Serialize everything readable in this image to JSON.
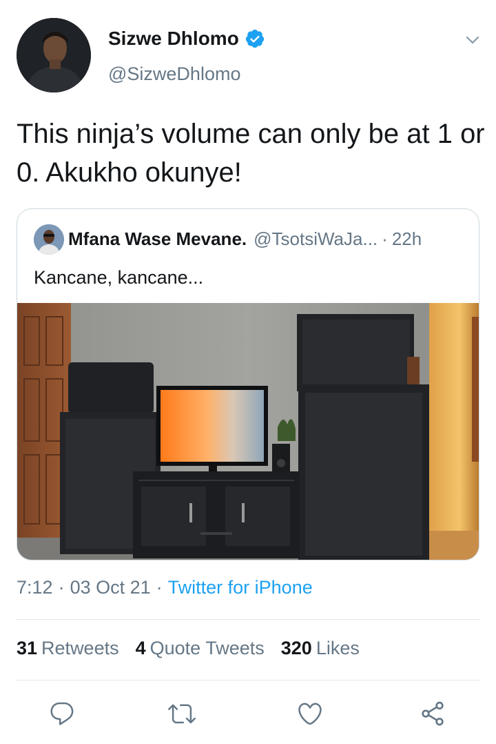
{
  "author": {
    "name": "Sizwe Dhlomo",
    "handle": "@SizweDhlomo",
    "verified": true
  },
  "tweet": {
    "text": "This ninja’s volume can only be at 1 or 0. Akukho okunye!"
  },
  "quoted_tweet": {
    "name": "Mfana Wase Mevane.",
    "handle": "@TsotsiWaJa...",
    "time": "22h",
    "text": "Kancane, kancane..."
  },
  "meta": {
    "time": "7:12",
    "date": "03 Oct 21",
    "source": "Twitter for iPhone"
  },
  "stats": {
    "retweets_count": "31",
    "retweets_label": "Retweets",
    "quotes_count": "4",
    "quotes_label": "Quote Tweets",
    "likes_count": "320",
    "likes_label": "Likes"
  },
  "actions": [
    "reply-icon",
    "retweet-icon",
    "like-icon",
    "share-icon"
  ],
  "colors": {
    "accent": "#1da1f2",
    "secondary_text": "#657786",
    "primary_text": "#14171a",
    "divider": "#e1e8ed"
  }
}
